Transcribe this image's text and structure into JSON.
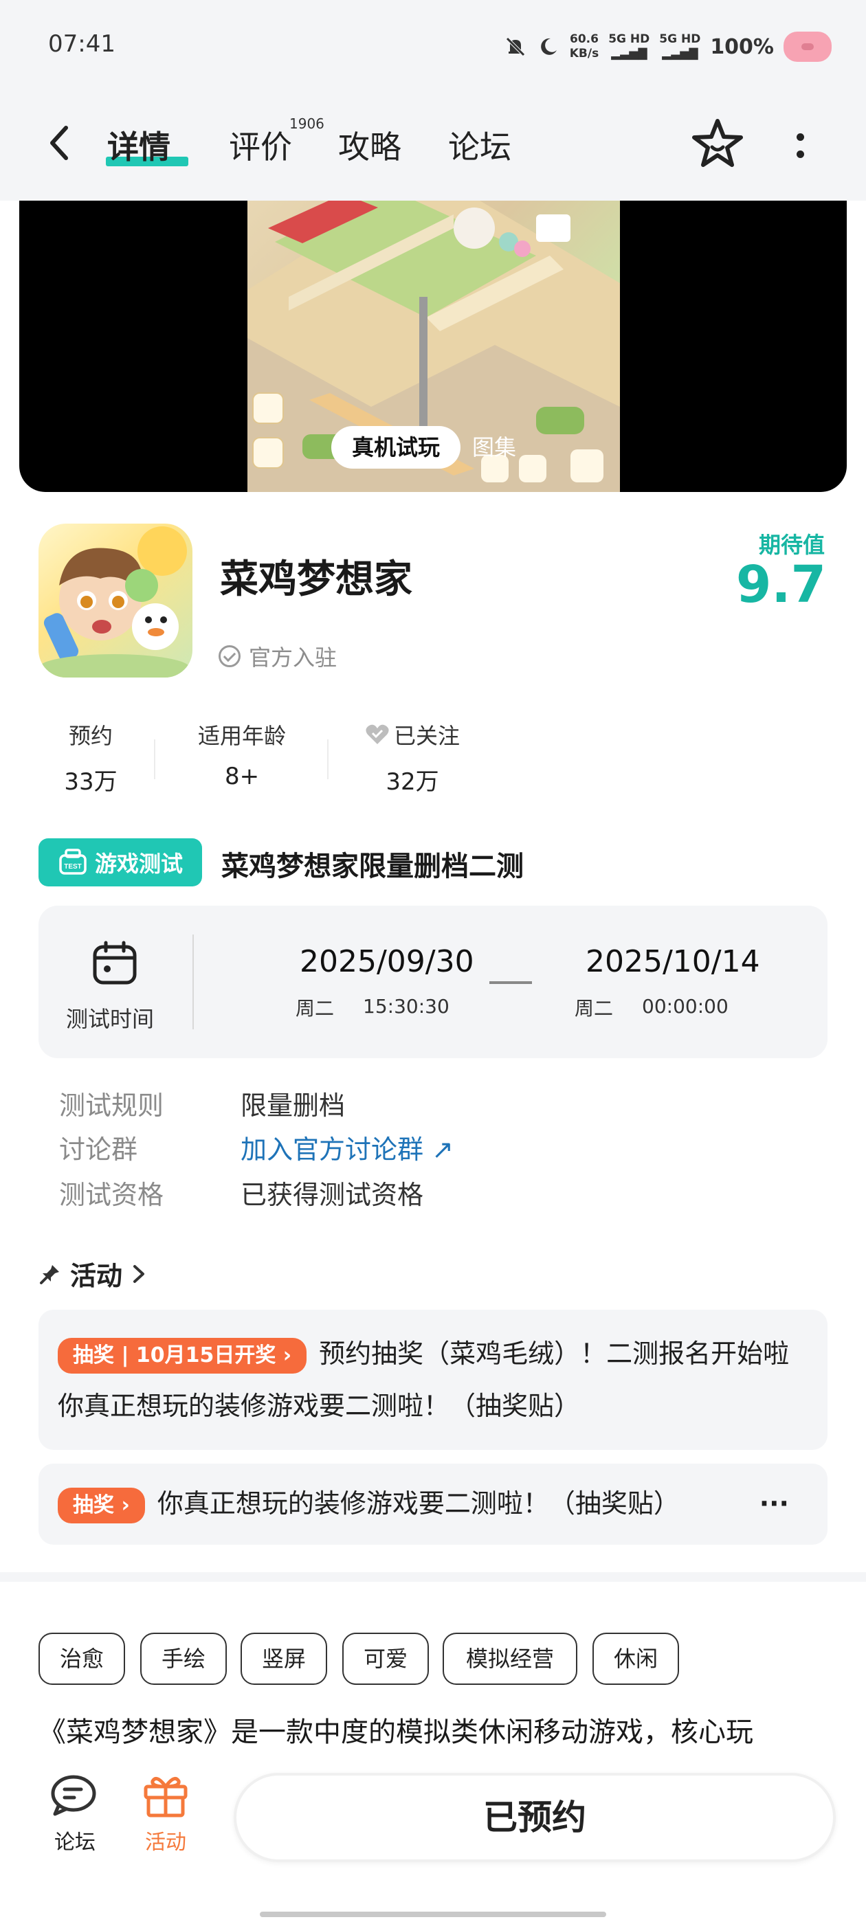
{
  "status_bar": {
    "time": "07:41",
    "net_speed_value": "60.6",
    "net_speed_unit": "KB/s",
    "signal_1": "5G HD",
    "signal_2": "5G HD",
    "battery": "100%"
  },
  "header": {
    "tabs": [
      {
        "label": "详情",
        "active": true
      },
      {
        "label": "评价",
        "badge": "1906"
      },
      {
        "label": "攻略"
      },
      {
        "label": "论坛"
      }
    ],
    "accent_color": "#20c7b4"
  },
  "media": {
    "demo_label": "真机试玩",
    "gallery_label": "图集"
  },
  "app": {
    "name": "菜鸡梦想家",
    "official_label": "官方入驻",
    "expectation_label": "期待值",
    "expectation_value": "9.7"
  },
  "stats": [
    {
      "label": "预约",
      "value": "33万"
    },
    {
      "label": "适用年龄",
      "value": "8+"
    },
    {
      "label": "已关注",
      "value": "32万"
    }
  ],
  "test": {
    "badge": "游戏测试",
    "badge_sub": "TEST",
    "title": "菜鸡梦想家限量删档二测",
    "time_label": "测试时间",
    "start_date": "2025/09/30",
    "start_day": "周二",
    "start_time": "15:30:30",
    "end_date": "2025/10/14",
    "end_day": "周二",
    "end_time": "00:00:00",
    "rows": [
      {
        "label": "测试规则",
        "value": "限量删档"
      },
      {
        "label": "讨论群",
        "value": "加入官方讨论群 ↗"
      },
      {
        "label": "测试资格",
        "value": "已获得测试资格"
      }
    ]
  },
  "activity": {
    "heading": "活动",
    "items": [
      {
        "badge": "抽奖 | 10月15日开奖 ›",
        "text": "预约抽奖（菜鸡毛绒）！二测报名开始啦 你真正想玩的装修游戏要二测啦！（抽奖贴）"
      },
      {
        "badge": "抽奖 ›",
        "text": "你真正想玩的装修游戏要二测啦！（抽奖贴）",
        "more": "···"
      }
    ]
  },
  "tags": [
    "治愈",
    "手绘",
    "竖屏",
    "可爱",
    "模拟经营",
    "休闲"
  ],
  "description": "《菜鸡梦想家》是一款中度的模拟类休闲移动游戏，核心玩",
  "bottom": {
    "forum_label": "论坛",
    "activity_label": "活动",
    "reserve_label": "已预约",
    "activity_color": "#f5793b"
  }
}
